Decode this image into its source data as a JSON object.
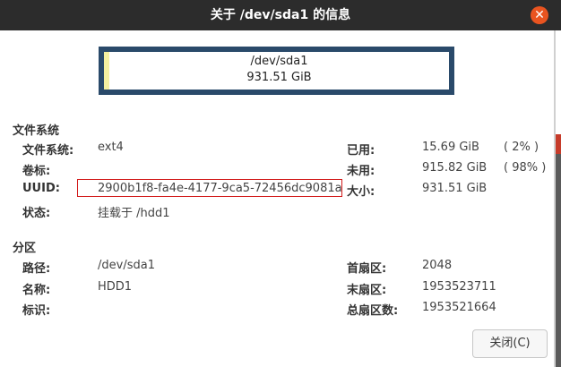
{
  "window": {
    "title": "关于 /dev/sda1 的信息"
  },
  "usage_bar": {
    "device": "/dev/sda1",
    "size": "931.51 GiB",
    "used_fraction": 0.02
  },
  "filesystem": {
    "heading": "文件系统",
    "type_label": "文件系统:",
    "type_value": "ext4",
    "volume_label": "卷标:",
    "volume_value": "",
    "uuid_label": "UUID:",
    "uuid_value": "2900b1f8-fa4e-4177-9ca5-72456dc9081a",
    "status_label": "状态:",
    "status_value": "挂载于 /hdd1",
    "used_label": "已用:",
    "used_value": "15.69 GiB",
    "used_pct": "( 2% )",
    "unused_label": "未用:",
    "unused_value": "915.82 GiB",
    "unused_pct": "( 98% )",
    "size_label": "大小:",
    "size_value": "931.51 GiB"
  },
  "partition": {
    "heading": "分区",
    "path_label": "路径:",
    "path_value": "/dev/sda1",
    "name_label": "名称:",
    "name_value": "HDD1",
    "flags_label": "标识:",
    "flags_value": "",
    "first_sector_label": "首扇区:",
    "first_sector_value": "2048",
    "last_sector_label": "末扇区:",
    "last_sector_value": "1953523711",
    "total_sectors_label": "总扇区数:",
    "total_sectors_value": "1953521664"
  },
  "buttons": {
    "close": "关闭(C)"
  },
  "icons": {
    "close": "close-icon"
  },
  "colors": {
    "titlebar": "#2c2c2c",
    "close_accent": "#e95420",
    "bar_border": "#2a4a6a",
    "highlight": "#d21a1a"
  }
}
